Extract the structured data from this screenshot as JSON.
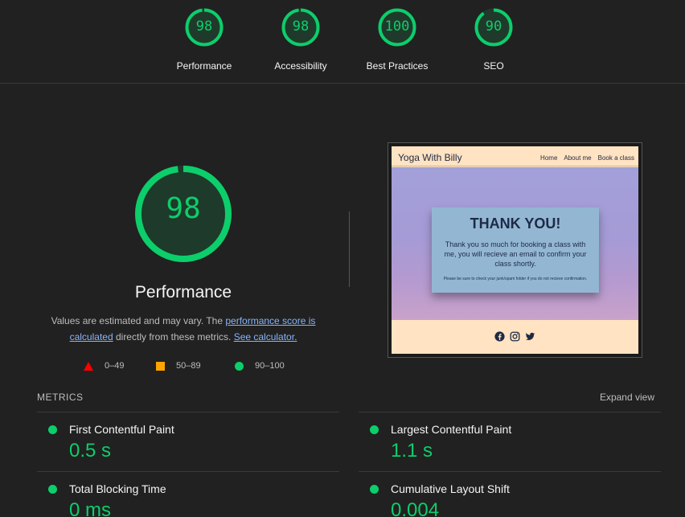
{
  "gauges": [
    {
      "score": "98",
      "label": "Performance",
      "fraction": 0.98
    },
    {
      "score": "98",
      "label": "Accessibility",
      "fraction": 0.98
    },
    {
      "score": "100",
      "label": "Best Practices",
      "fraction": 1.0
    },
    {
      "score": "90",
      "label": "SEO",
      "fraction": 0.9
    }
  ],
  "main": {
    "score": "98",
    "fraction": 0.98,
    "title": "Performance",
    "desc_prefix": "Values are estimated and may vary. The ",
    "desc_link1": "performance score is calculated",
    "desc_middle": " directly from these metrics. ",
    "desc_link2": "See calculator."
  },
  "legend": [
    {
      "range": "0–49",
      "shape": "triangle",
      "color": "#ff0000"
    },
    {
      "range": "50–89",
      "shape": "square",
      "color": "#ffa400"
    },
    {
      "range": "90–100",
      "shape": "circle",
      "color": "#0cce6b"
    }
  ],
  "preview": {
    "brand": "Yoga With Billy",
    "nav": [
      "Home",
      "About me",
      "Book a class"
    ],
    "card_title": "THANK YOU!",
    "card_text": "Thank you so much for booking a class with me, you will recieve an email to confirm your class shortly.",
    "card_small": "Please be sure to check your junk/spam folder if you do not recieve confirmation.",
    "icons": [
      "facebook-icon",
      "instagram-icon",
      "twitter-icon"
    ]
  },
  "metrics": {
    "label": "METRICS",
    "expand_label": "Expand view",
    "items": [
      {
        "name": "First Contentful Paint",
        "value": "0.5 s"
      },
      {
        "name": "Largest Contentful Paint",
        "value": "1.1 s"
      },
      {
        "name": "Total Blocking Time",
        "value": "0 ms"
      },
      {
        "name": "Cumulative Layout Shift",
        "value": "0.004"
      }
    ]
  },
  "colors": {
    "pass": "#0cce6b",
    "average": "#ffa400",
    "fail": "#ff0000",
    "background": "#212121",
    "link": "#8ab4f8"
  }
}
